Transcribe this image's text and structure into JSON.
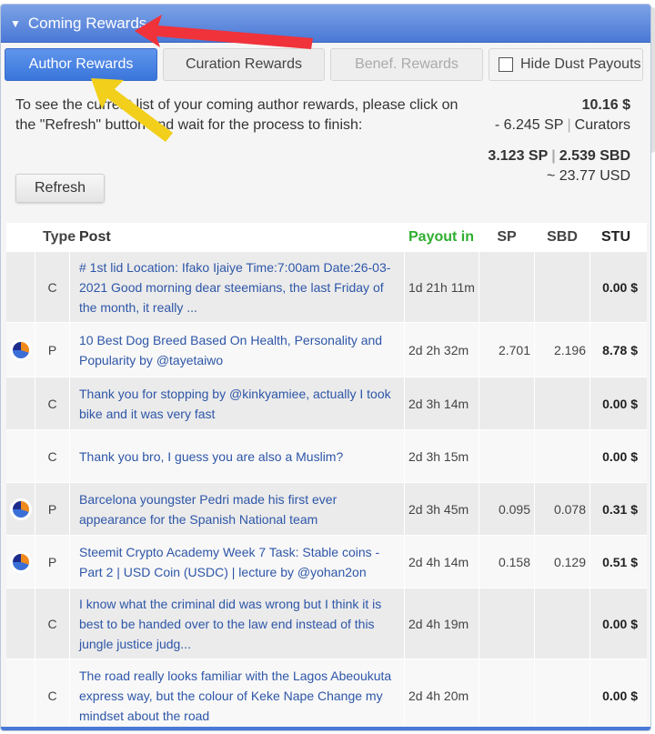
{
  "header": {
    "title": "Coming Rewards"
  },
  "tabs": {
    "author": "Author Rewards",
    "curation": "Curation Rewards",
    "benef": "Benef. Rewards",
    "dust": "Hide Dust Payouts"
  },
  "info": {
    "message": "To see the current list of your coming author rewards, please click on the \"Refresh\" button and wait for the process to finish:",
    "refresh_label": "Refresh"
  },
  "totals": {
    "usd": "10.16 $",
    "curators_sp": "- 6.245 SP",
    "curators_label": "Curators",
    "sp": "3.123 SP",
    "sbd": "2.539 SBD",
    "approx_usd": "~ 23.77 USD"
  },
  "table": {
    "headers": {
      "type": "Type",
      "post": "Post",
      "payout": "Payout in",
      "sp": "SP",
      "sbd": "SBD",
      "stu": "STU"
    },
    "rows": [
      {
        "type": "C",
        "post": "# 1st lid Location: Ifako Ijaiye Time:7:00am Date:26-03-2021 Good morning dear steemians, the last Friday of the month, it really ...",
        "payout": "1d 21h 11m",
        "sp": "",
        "sbd": "",
        "stu": "0.00 $",
        "icon": ""
      },
      {
        "type": "P",
        "post": "10 Best Dog Breed Based On Health, Personality and Popularity by @tayetaiwo",
        "payout": "2d 2h 32m",
        "sp": "2.701",
        "sbd": "2.196",
        "stu": "8.78 $",
        "icon": "pie-chart-icon"
      },
      {
        "type": "C",
        "post": "Thank you for stopping by @kinkyamiee, actually I took bike and it was very fast",
        "payout": "2d 3h 14m",
        "sp": "",
        "sbd": "",
        "stu": "0.00 $",
        "icon": ""
      },
      {
        "type": "C",
        "post": "Thank you bro, I guess you are also a Muslim?",
        "payout": "2d 3h 15m",
        "sp": "",
        "sbd": "",
        "stu": "0.00 $",
        "icon": ""
      },
      {
        "type": "P",
        "post": "Barcelona youngster Pedri made his first ever appearance for the Spanish National team",
        "payout": "2d 3h 45m",
        "sp": "0.095",
        "sbd": "0.078",
        "stu": "0.31 $",
        "icon": "pie-chart-icon"
      },
      {
        "type": "P",
        "post": "Steemit Crypto Academy Week 7 Task: Stable coins - Part 2 | USD Coin (USDC) | lecture by @yohan2on",
        "payout": "2d 4h 14m",
        "sp": "0.158",
        "sbd": "0.129",
        "stu": "0.51 $",
        "icon": "pie-chart-icon"
      },
      {
        "type": "C",
        "post": "I know what the criminal did was wrong but I think it is best to be handed over to the law end instead of this jungle justice judg...",
        "payout": "2d 4h 19m",
        "sp": "",
        "sbd": "",
        "stu": "0.00 $",
        "icon": ""
      },
      {
        "type": "C",
        "post": "The road really looks familiar with the Lagos Abeoukuta express way, but the colour of Keke Nape Change my mindset about the road",
        "payout": "2d 4h 20m",
        "sp": "",
        "sbd": "",
        "stu": "0.00 $",
        "icon": ""
      }
    ]
  },
  "colors": {
    "accent": "#3a75db",
    "payout_header": "#2fae2f",
    "link": "#2e56a8",
    "annotation_red": "#f0323a",
    "annotation_yellow": "#f2cf1a"
  }
}
